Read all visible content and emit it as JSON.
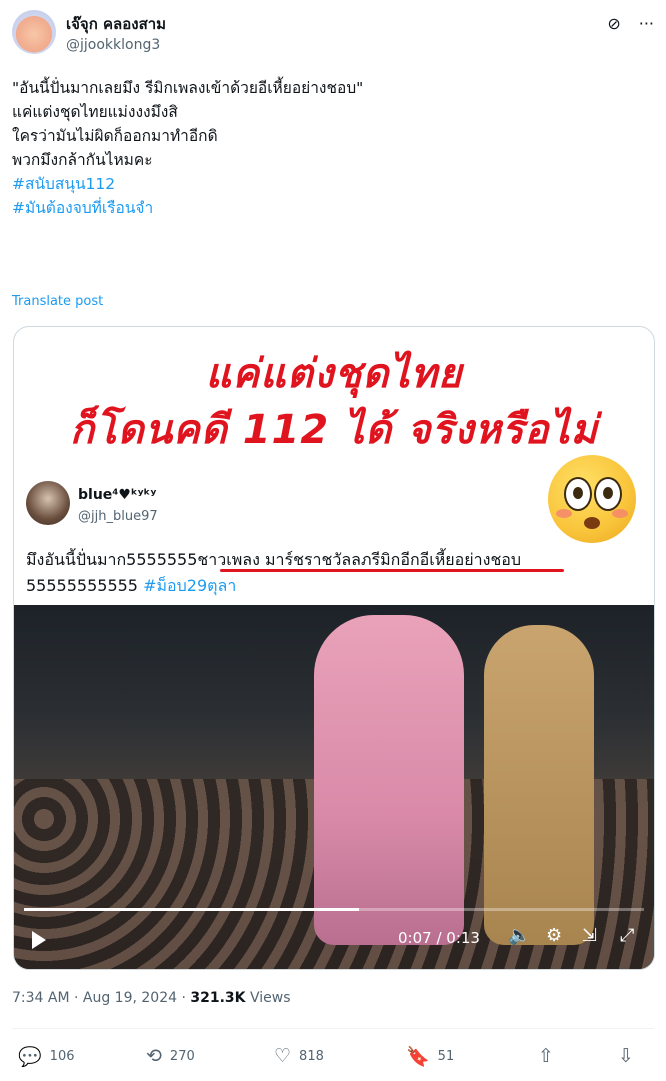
{
  "author": {
    "name": "เจ๊จุก คลองสาม",
    "handle": "@jjookklong3"
  },
  "top_icons": [
    "grok-icon",
    "more-icon"
  ],
  "post": {
    "lines": [
      "\"อันนี้ปั่นมากเลยมึง รีมิกเพลงเข้าด้วยอีเหี้ยอย่างชอบ\"",
      "",
      "แค่แต่งชุดไทยแม่งงงมึงสิ",
      "ใครว่ามันไม่ผิดก็ออกมาทำอีกดิ",
      "พวกมึงกล้ากันไหมคะ",
      ""
    ],
    "hashtags": [
      "#สนับสนุน112",
      "#มันต้องจบที่เรือนจำ"
    ],
    "translate": "Translate post"
  },
  "media": {
    "headline_1": "แค่แต่งชุดไทย",
    "headline_2": "ก็โดนคดี 112 ได้ จริงหรือไม่",
    "quoted": {
      "name": "blue⁴♥ᵏʸᵏʸ",
      "handle": "@jjh_blue97",
      "text_part1": "มึงอันนี้ปั่นมาก5555555",
      "text_underlined": "ชาวเพลง มาร์ชราชวัลลภรีมิกอีกอีเหี้ยอย่างชอบ",
      "text_part2": "55555555555 ",
      "hashtag": "#ม็อบ29ตุลา"
    },
    "video": {
      "time": "0:07 / 0:13",
      "progress": 0.54
    }
  },
  "meta": {
    "time": "7:34 AM · Aug 19, 2024 · ",
    "views": "321.3K",
    "views_label": " Views"
  },
  "actions": {
    "replies": "106",
    "reposts": "270",
    "likes": "818",
    "bookmarks": "51"
  },
  "colors": {
    "accent": "#1d9bf0",
    "headline_red": "#e0141e",
    "muted": "#536471"
  }
}
